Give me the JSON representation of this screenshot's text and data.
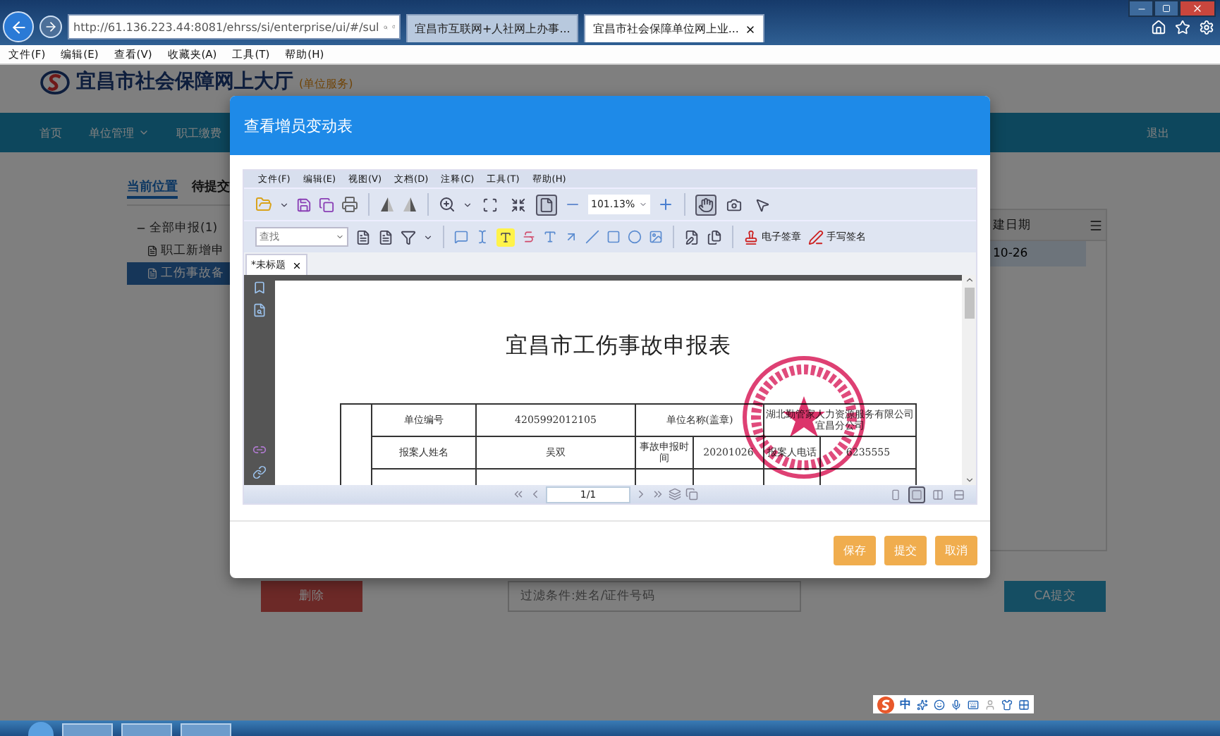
{
  "browser": {
    "address": "http://61.136.223.44:8081/ehrss/si/enterprise/ui/#/sul",
    "tabs": [
      {
        "label": "宜昌市互联网+人社网上办事...",
        "selected": false
      },
      {
        "label": "宜昌市社会保障单位网上业...",
        "selected": true
      }
    ],
    "menu": [
      "文件(F)",
      "编辑(E)",
      "查看(V)",
      "收藏夹(A)",
      "工具(T)",
      "帮助(H)"
    ]
  },
  "site": {
    "title": "宜昌市社会保障网上大厅",
    "subtitle": "(单位服务)",
    "nav": [
      {
        "label": "首页",
        "dropdown": false
      },
      {
        "label": "单位管理",
        "dropdown": true
      },
      {
        "label": "职工缴费",
        "dropdown": false
      }
    ],
    "logout": "退出"
  },
  "page_tabs": [
    {
      "label": "当前位置",
      "selected": true
    },
    {
      "label": "待提交",
      "selected": false
    }
  ],
  "tree": {
    "label": "全部申报(1)",
    "expanded": true,
    "children": [
      {
        "label": "职工新增申",
        "selected": false
      },
      {
        "label": "工伤事故备",
        "selected": true
      }
    ]
  },
  "table": {
    "column": "建日期",
    "rows": [
      {
        "cell": "10-26",
        "selected": true
      }
    ]
  },
  "actions": {
    "delete": "删除",
    "filter_placeholder": "过滤条件:姓名/证件号码",
    "ca_submit": "CA提交"
  },
  "dialog": {
    "title": "查看增员变动表",
    "viewer_menu": [
      "文件(F)",
      "编辑(E)",
      "视图(V)",
      "文档(D)",
      "注释(C)",
      "工具(T)",
      "帮助(H)"
    ],
    "fit_modes": [
      {
        "selected": false
      },
      {
        "selected": false
      },
      {
        "selected": true
      }
    ],
    "zoom": "101.13%",
    "tool_modes": [
      {
        "selected": true
      },
      {
        "selected": false
      },
      {
        "selected": false
      }
    ],
    "find_placeholder": "查找",
    "stamp": "电子签章",
    "handwrite": "手写签名",
    "doc_tab": "*未标题",
    "document": {
      "title": "宜昌市工伤事故申报表",
      "rows": [
        [
          {
            "text": "单位编号"
          },
          {
            "text": "4205992012105"
          },
          {
            "text": "单位名称(盖章)",
            "colspan": 2
          },
          {
            "text": "湖北勤管家人力资源服务有限公司宜昌分公司",
            "colspan": 2
          }
        ],
        [
          {
            "text": "报案人姓名"
          },
          {
            "text": "吴双"
          },
          {
            "text": "事故申报时间"
          },
          {
            "text": "20201026"
          },
          {
            "text": "报案人电话"
          },
          {
            "text": "6235555"
          }
        ]
      ]
    },
    "page": "1/1",
    "view_modes": [
      {
        "selected": false
      },
      {
        "selected": true
      },
      {
        "selected": false
      },
      {
        "selected": false
      }
    ],
    "buttons": [
      "保存",
      "提交",
      "取消"
    ]
  },
  "ime": {
    "label": "中"
  }
}
